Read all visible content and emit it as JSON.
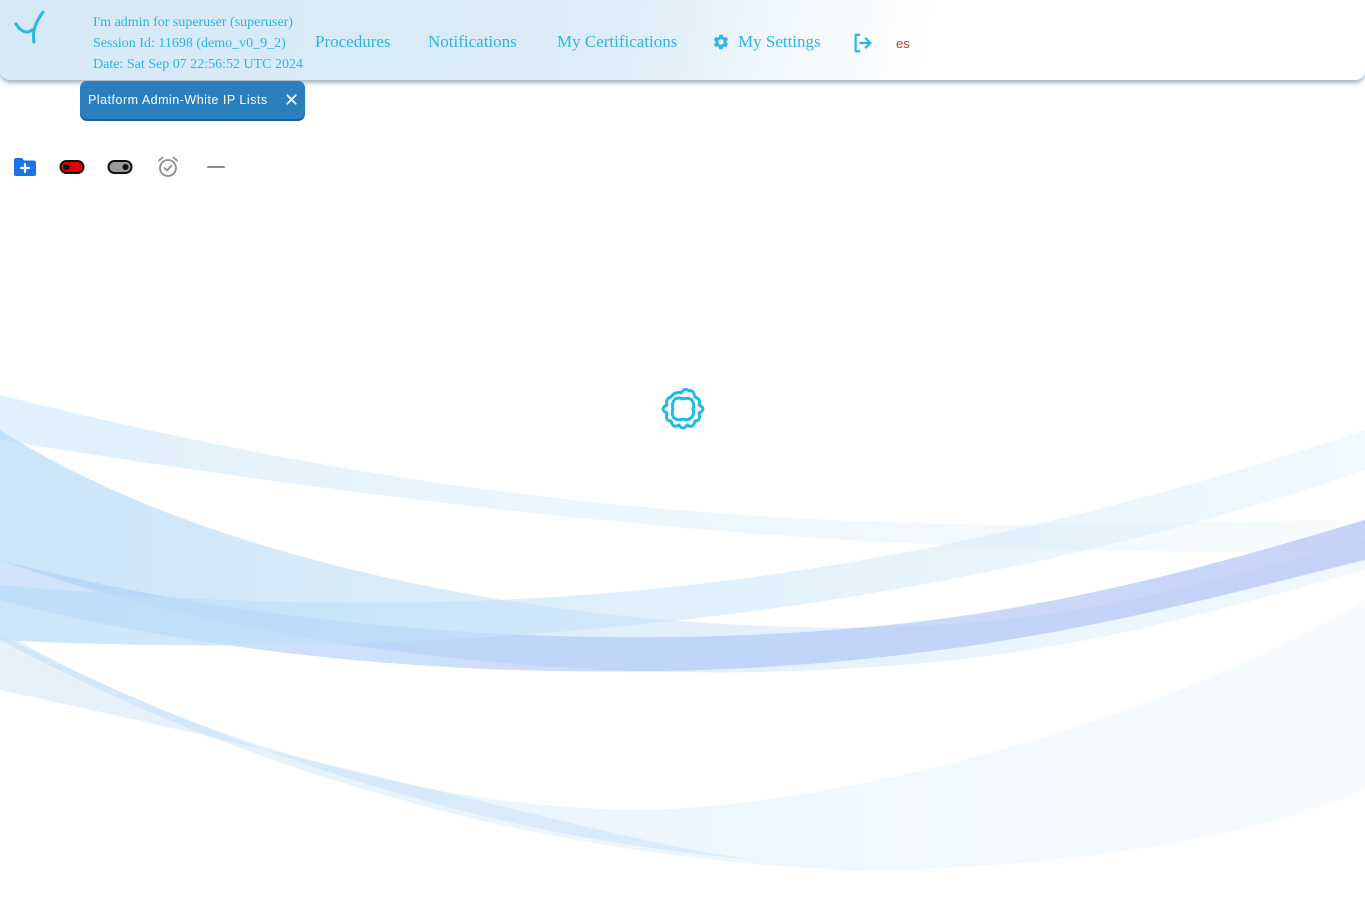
{
  "header": {
    "user_line": "I'm admin for superuser (superuser)",
    "session_line": "Session Id: 11698 (demo_v0_9_2)",
    "date_line": "Date: Sat Sep 07 22:56:52 UTC 2024",
    "nav": {
      "procedures": "Procedures",
      "notifications": "Notifications",
      "certifications": "My Certifications",
      "settings": "My Settings"
    },
    "language": "es"
  },
  "tabs": [
    {
      "label": "Platform Admin-White IP Lists"
    }
  ],
  "toolbar": {
    "icons": [
      "new-folder-icon",
      "toggle-on-red-icon",
      "toggle-off-icon",
      "alarm-check-icon",
      "minus-icon"
    ]
  },
  "colors": {
    "accent": "#2bb5e3",
    "tab_bg": "#2a7fbd",
    "language": "#c0392b",
    "new_folder": "#1a73e8",
    "toggle_active": "#e00000"
  }
}
